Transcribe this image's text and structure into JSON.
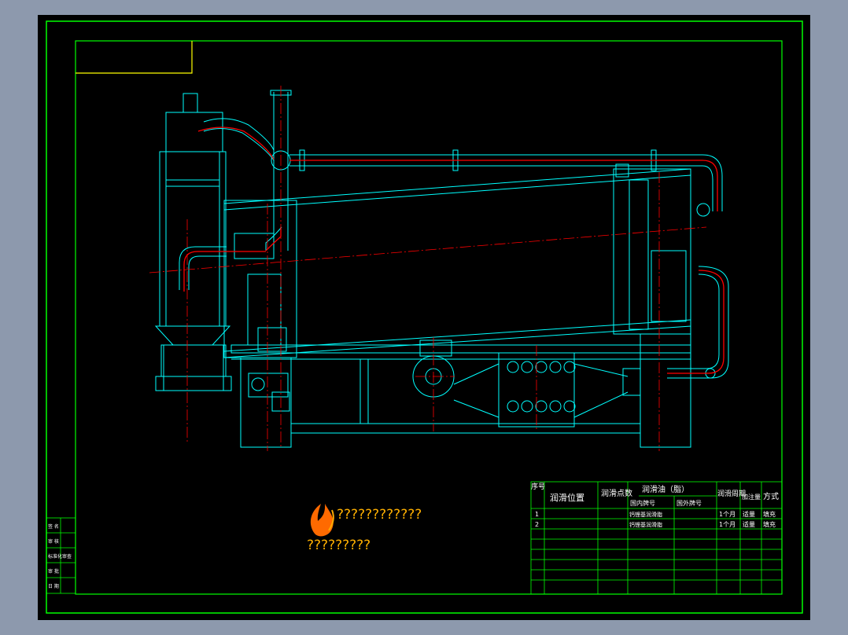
{
  "drawing": {
    "logo_text": "????????????",
    "logo_subtext": "?????????"
  },
  "lubrication_table": {
    "headers": {
      "seq": "序号",
      "position": "润滑位置",
      "points": "润滑点数",
      "oil": "润滑油（脂）",
      "domestic": "国内牌号",
      "foreign": "国外牌号",
      "cycle": "润滑周期",
      "amount": "加注量",
      "method": "方式"
    },
    "rows": [
      {
        "seq": "1",
        "domestic": "钙锂基润滑脂",
        "cycle": "1个月",
        "amount": "适量",
        "method": "填充"
      },
      {
        "seq": "2",
        "domestic": "钙锂基润滑脂",
        "cycle": "1个月",
        "amount": "适量",
        "method": "填充"
      }
    ]
  },
  "side_labels": [
    "签 名",
    "审 核",
    "标准化审查",
    "审 批",
    "日 期"
  ],
  "colors": {
    "frame": "#00ff00",
    "title_box": "#ffff00",
    "machine": "#00ffff",
    "pipe": "#ff0000",
    "table_text": "#ffffff",
    "logo": "#ff6a00"
  }
}
